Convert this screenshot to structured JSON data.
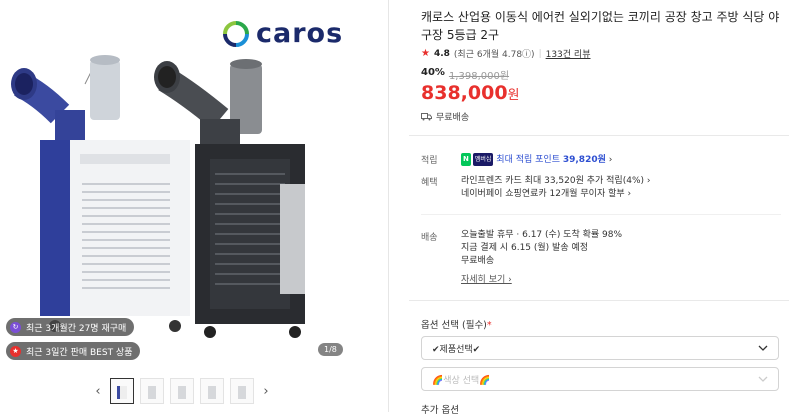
{
  "brand": {
    "logo_text": "caros"
  },
  "gallery": {
    "badges": [
      {
        "text": "최근 3개월간 27명 재구매",
        "icon": "repeat-icon",
        "color": "#7b4fd6"
      },
      {
        "text": "최근 3일간 판매 BEST 상품",
        "icon": "trophy-icon",
        "color": "#e8302d"
      }
    ],
    "counter": "1/8",
    "prev_label": "‹",
    "next_label": "›"
  },
  "product": {
    "title": "캐로스 산업용 이동식 에어컨 실외기없는 코끼리 공장 창고 주방 식당 야구장 5등급 2구",
    "rating": "4.8",
    "rating_detail": "(최근 6개월 4.78ⓘ)",
    "review_count": "133건 리뷰",
    "discount_pct": "40%",
    "original_price": "1,398,000원",
    "price": "838,000",
    "price_unit": "원",
    "shipping": "무료배송"
  },
  "benefits": {
    "points_label": "적립",
    "npay_n": "N",
    "npay_m": "멤버십",
    "points_text": "최대 적립 포인트",
    "points_value": "39,820원",
    "points_chevron": "›",
    "benefit_label": "혜택",
    "benefit_lines": [
      "라인프렌즈 카드 최대 33,520원 추가 적립(4%) ›",
      "네이버페이 쇼핑연료카 12개월 무이자 할부 ›"
    ]
  },
  "delivery": {
    "label": "배송",
    "line1": "오늘출발 휴무 · 6.17 (수) 도착 확률 98%",
    "line2": "지금 결제 시 6.15 (월) 발송 예정",
    "line3": "무료배송",
    "detail_link": "자세히 보기 ›"
  },
  "options": {
    "label": "옵션 선택 (필수)",
    "required_mark": "*",
    "select1": "✔제품선택✔",
    "select2": "🌈색상 선택🌈",
    "add_label": "추가 옵션"
  },
  "colors": {
    "accent": "#e8302d",
    "point": "#2e4fd1",
    "npay": "#03c75a"
  }
}
